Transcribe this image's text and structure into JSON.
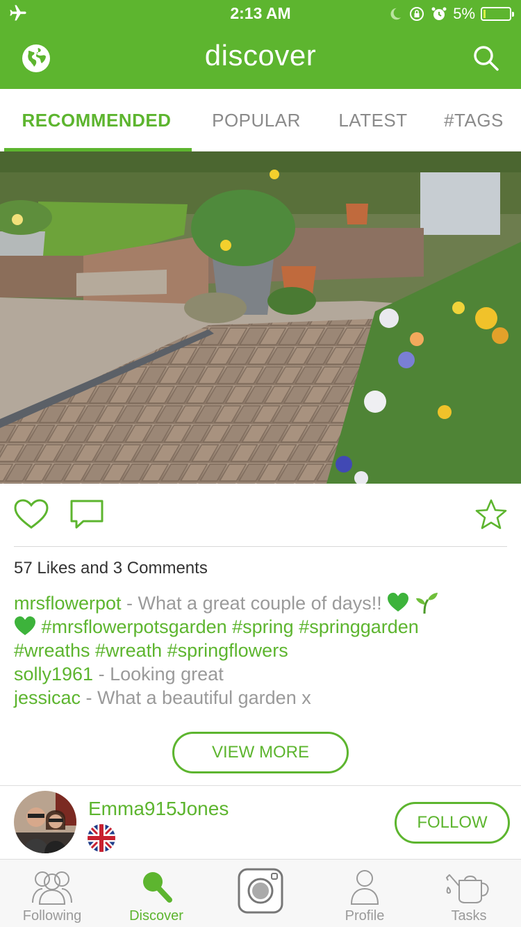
{
  "status": {
    "time": "2:13 AM",
    "battery": "5%"
  },
  "header": {
    "title": "discover"
  },
  "tabs": [
    {
      "label": "RECOMMENDED",
      "active": true
    },
    {
      "label": "POPULAR"
    },
    {
      "label": "LATEST"
    },
    {
      "label": "#TAGS"
    }
  ],
  "post": {
    "likes_text": "57 Likes and 3 Comments",
    "caption": {
      "user": "mrsflowerpot",
      "text": " - What a great couple of days!! ",
      "tags_line1": "#mrsflowerpotsgarden #spring #springgarden",
      "tags_line2": "#wreaths #wreath #springflowers"
    },
    "comments": [
      {
        "user": "solly1961",
        "text": " - Looking great"
      },
      {
        "user": "jessicac",
        "text": " - What a beautiful garden x"
      }
    ],
    "view_more": "VIEW MORE"
  },
  "suggested_user": {
    "name": "Emma915Jones",
    "follow": "FOLLOW"
  },
  "nav": [
    {
      "label": "Following"
    },
    {
      "label": "Discover",
      "active": true
    },
    {
      "label": ""
    },
    {
      "label": "Profile"
    },
    {
      "label": "Tasks"
    }
  ],
  "colors": {
    "brand": "#5db52f",
    "muted": "#9a9a9a"
  }
}
